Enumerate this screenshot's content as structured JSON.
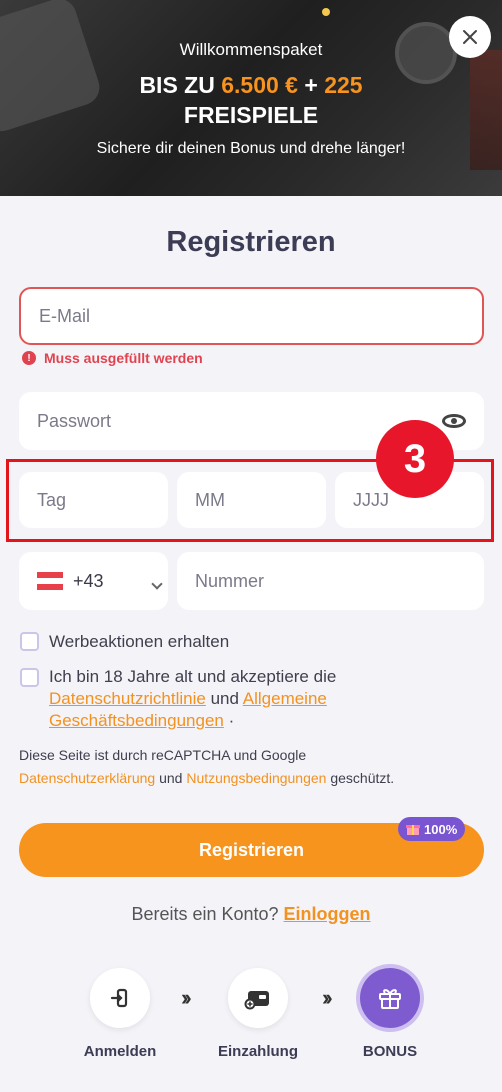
{
  "banner": {
    "subtitle": "Willkommenspaket",
    "title_prefix": "BIS ZU",
    "amount": "6.500 €",
    "plus": "+",
    "spins": "225",
    "title_line2": "FREISPIELE",
    "description": "Sichere dir deinen Bonus und drehe länger!"
  },
  "form": {
    "title": "Registrieren",
    "email_placeholder": "E-Mail",
    "email_error": "Muss ausgefüllt werden",
    "password_placeholder": "Passwort",
    "day_placeholder": "Tag",
    "month_placeholder": "MM",
    "year_placeholder": "JJJJ",
    "step_number": "3",
    "country_code": "+43",
    "phone_placeholder": "Nummer",
    "promo_label": "Werbeaktionen erhalten",
    "terms_prefix": "Ich bin 18 Jahre alt und akzeptiere die",
    "privacy_link": "Datenschutzrichtlinie",
    "and": "und",
    "terms_link": "Allgemeine Geschäftsbedingungen",
    "terms_suffix": "·",
    "recaptcha_text": "Diese Seite ist durch reCAPTCHA und Google",
    "recaptcha_privacy": "Datenschutzerklärung",
    "recaptcha_and": "und",
    "recaptcha_terms": "Nutzungsbedingungen",
    "recaptcha_suffix": "geschützt.",
    "register_button": "Registrieren",
    "badge_text": "100%",
    "login_prompt": "Bereits ein Konto?",
    "login_link": "Einloggen"
  },
  "steps": [
    {
      "label": "Anmelden",
      "icon": "login-icon"
    },
    {
      "label": "Einzahlung",
      "icon": "deposit-icon"
    },
    {
      "label": "BONUS",
      "icon": "gift-icon"
    }
  ],
  "colors": {
    "accent": "#f7941d",
    "error": "#e0434f",
    "purple": "#7a55d1",
    "highlight": "#e3141c"
  }
}
